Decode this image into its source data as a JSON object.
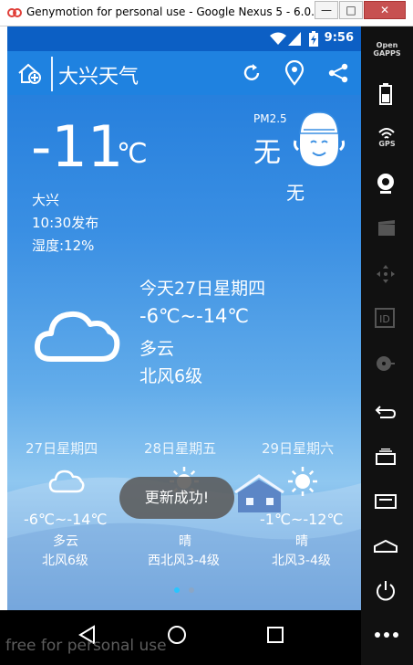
{
  "window": {
    "title": "Genymotion for personal use - Google Nexus 5 - 6.0..."
  },
  "status_bar": {
    "time": "9:56"
  },
  "app_bar": {
    "city": "大兴天气"
  },
  "current": {
    "temp": "-11",
    "unit": "℃",
    "location": "大兴",
    "publish_time": "10:30发布",
    "humidity": "湿度:12%",
    "pm_label": "PM2.5",
    "pm_value": "无",
    "quality": "无"
  },
  "today": {
    "date": "今天27日星期四",
    "temp_range": "-6℃~-14℃",
    "weather": "多云",
    "wind": "北风6级",
    "icon": "cloud-icon"
  },
  "forecast": [
    {
      "date": "27日星期四",
      "temp": "-6℃~-14℃",
      "weather": "多云",
      "wind": "北风6级",
      "icon": "cloud-icon"
    },
    {
      "date": "28日星期五",
      "temp": "",
      "weather": "晴",
      "wind": "西北风3-4级",
      "icon": "sun-icon"
    },
    {
      "date": "29日星期六",
      "temp": "-1℃~-12℃",
      "weather": "晴",
      "wind": "北风3-4级",
      "icon": "sun-icon"
    }
  ],
  "toast": "更新成功!",
  "side_panel": {
    "gapps": "Open GAPPS",
    "gps": "GPS",
    "id": "ID"
  },
  "watermark": "free for personal use",
  "colors": {
    "status_bar": "#0c5fc4",
    "app_bar": "#1f82e0",
    "close_button": "#c75050"
  }
}
